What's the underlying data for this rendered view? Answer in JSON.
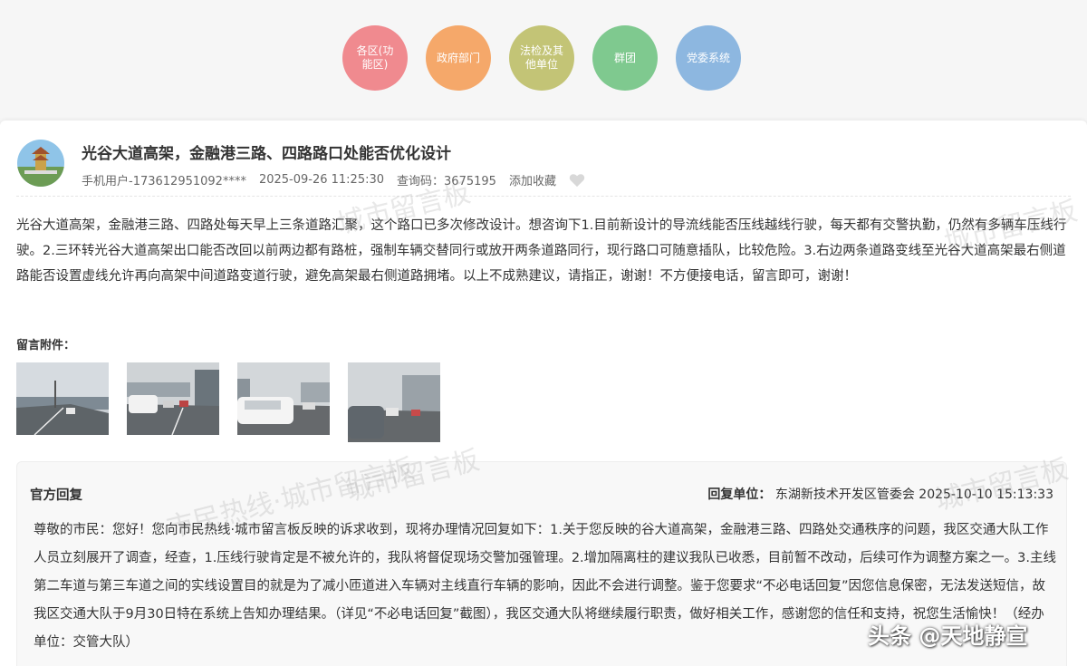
{
  "nav": {
    "categories": [
      {
        "label": "各区(功能区)",
        "color": "#f08a8f"
      },
      {
        "label": "政府部门",
        "color": "#f5a86a"
      },
      {
        "label": "法检及其他单位",
        "color": "#c3c476"
      },
      {
        "label": "群团",
        "color": "#7fc98f"
      },
      {
        "label": "党委系统",
        "color": "#8db7e0"
      }
    ]
  },
  "post": {
    "title": "光谷大道高架，金融港三路、四路路口处能否优化设计",
    "user": "手机用户-173612951092****",
    "datetime": "2025-09-26 11:25:30",
    "query_code": "查询码：3675195",
    "favorite": "添加收藏",
    "body": "光谷大道高架，金融港三路、四路处每天早上三条道路汇聚，这个路口已多次修改设计。想咨询下1.目前新设计的导流线能否压线越线行驶，每天都有交警执勤，仍然有多辆车压线行驶。2.三环转光谷大道高架出口能否改回以前两边都有路桩，强制车辆交替同行或放开两条道路同行，现行路口可随意插队，比较危险。3.右边两条道路变线至光谷大道高架最右侧道路能否设置虚线允许再向高架中间道路变道行驶，避免高架最右侧道路拥堵。以上不成熟建议，请指正，谢谢！不方便接电话，留言即可，谢谢！",
    "attachments_label": "留言附件："
  },
  "reply": {
    "heading": "官方回复",
    "unit_label": "回复单位：",
    "unit": "东湖新技术开发区管委会",
    "datetime": "2025-10-10 15:13:33",
    "body": "尊敬的市民：您好！您向市民热线·城市留言板反映的诉求收到，现将办理情况回复如下：1.关于您反映的谷大道高架，金融港三路、四路处交通秩序的问题，我区交通大队工作人员立刻展开了调查，经查，1.压线行驶肯定是不被允许的，我队将督促现场交警加强管理。2.增加隔离柱的建议我队已收悉，目前暂不改动，后续可作为调整方案之一。3.主线第二车道与第三车道之间的实线设置目的就是为了减小匝道进入车辆对主线直行车辆的影响，因此不会进行调整。鉴于您要求“不必电话回复”因您信息保密，无法发送短信，故我区交通大队于9月30日特在系统上告知办理结果。（详见“不必电话回复”截图），我区交通大队将继续履行职责，做好相关工作，感谢您的信任和支持，祝您生活愉快！（经办单位：交管大队）"
  },
  "watermarks": [
    "城市留言板",
    "城市留言板",
    "城市留言板",
    "城市留言板",
    "市民热线·城市留言板"
  ],
  "brand_tag": "头条 @天地静宣"
}
